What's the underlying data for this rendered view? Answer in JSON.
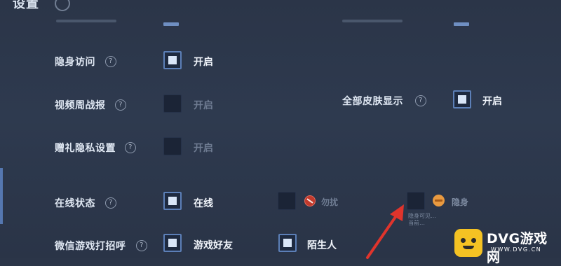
{
  "header": {
    "title": "设置"
  },
  "settings": {
    "stealth_visit": {
      "label": "隐身访问",
      "option": "开启",
      "checked": true
    },
    "video_weekly": {
      "label": "视频周战报",
      "option": "开启",
      "checked": false
    },
    "gift_privacy": {
      "label": "赠礼隐私设置",
      "option": "开启",
      "checked": false
    },
    "all_skins": {
      "label": "全部皮肤显示",
      "option": "开启",
      "checked": true
    },
    "online_status": {
      "label": "在线状态",
      "options": [
        {
          "label": "在线",
          "checked": true
        },
        {
          "label": "勿扰",
          "checked": false,
          "icon": "do-not-disturb-icon"
        },
        {
          "label": "隐身",
          "checked": false,
          "icon": "invisible-icon"
        }
      ],
      "tip": "隐身可见…\n当前…"
    },
    "wechat_greet": {
      "label": "微信游戏打招呼",
      "options": [
        {
          "label": "游戏好友",
          "checked": true
        },
        {
          "label": "陌生人",
          "checked": true
        }
      ]
    }
  },
  "watermark": {
    "brand": "DVG游戏网",
    "url": "WWW.DVG.CN"
  },
  "colors": {
    "accent": "#5c7fb7",
    "arrow": "#e0342c",
    "logo": "#f4c223"
  }
}
